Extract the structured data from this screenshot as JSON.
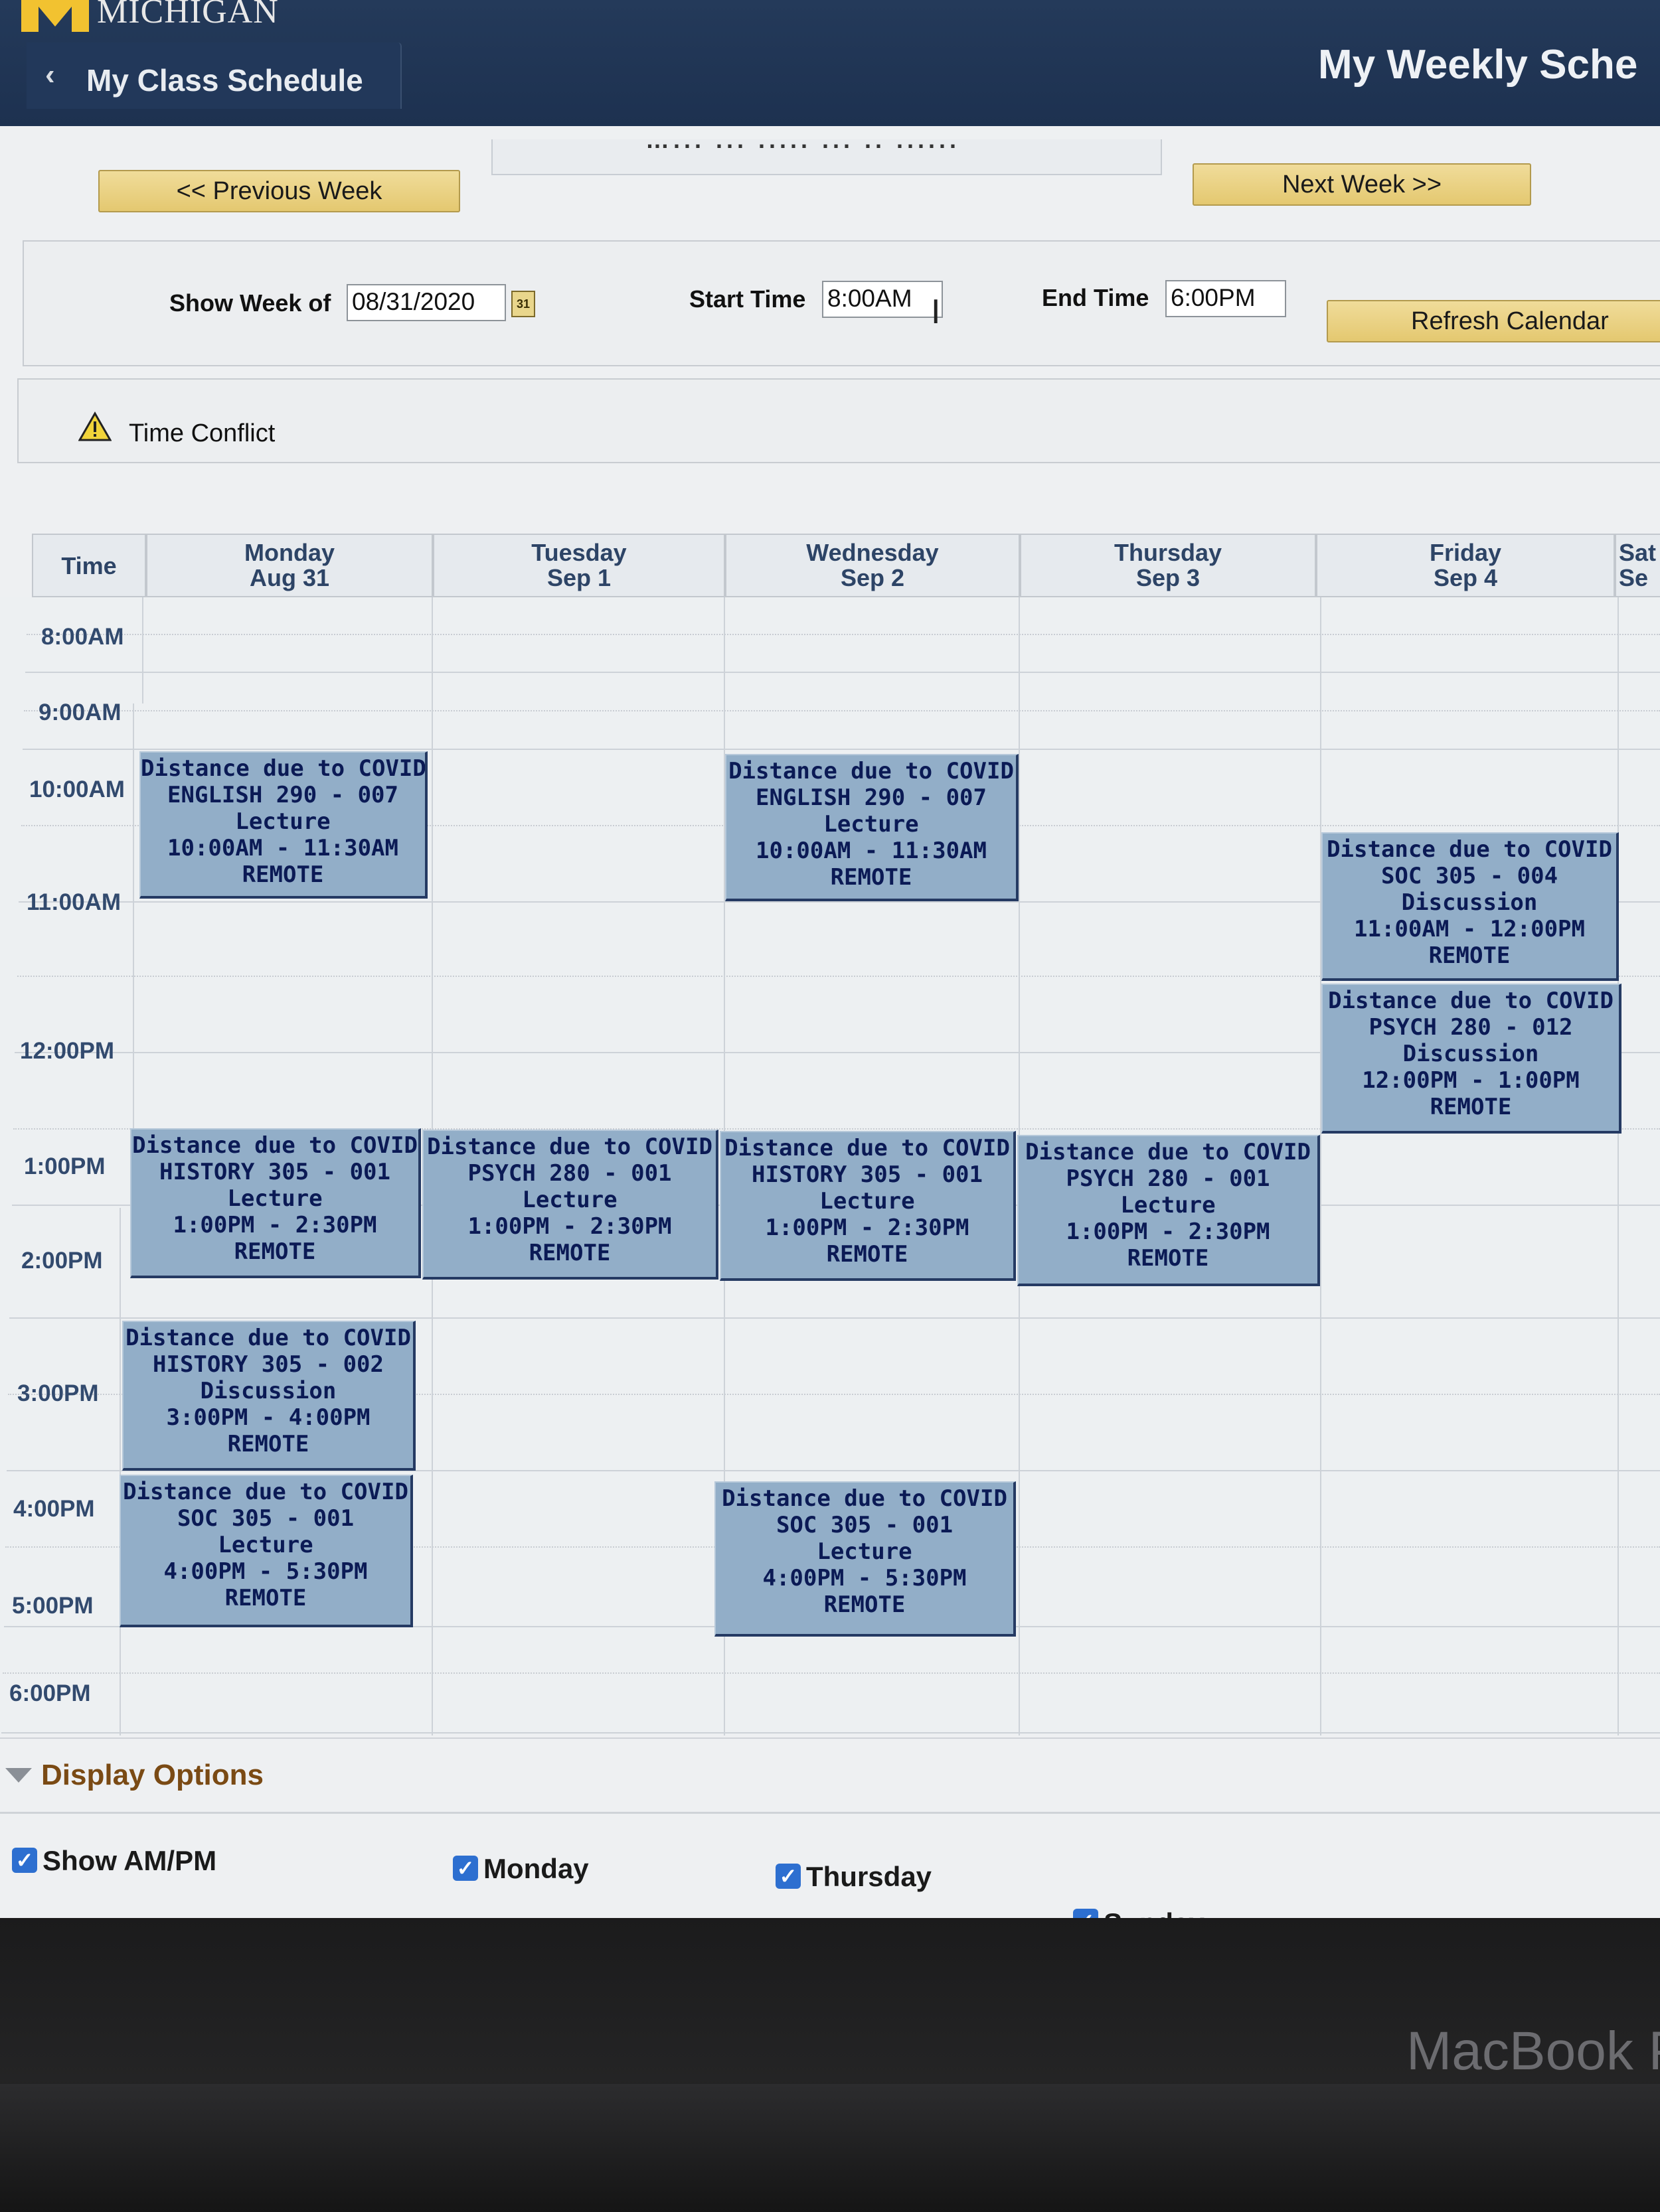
{
  "header": {
    "logo_letter": "M",
    "university": "MICHIGAN",
    "back_label": "My Class Schedule",
    "page_title": "My Weekly Sche"
  },
  "navigation": {
    "prev_week": "<< Previous Week",
    "next_week": "Next Week >>",
    "week_strip": "…... ... ..... ... .. ......"
  },
  "filters": {
    "show_week_label": "Show Week of",
    "show_week_value": "08/31/2020",
    "start_time_label": "Start Time",
    "start_time_value": "8:00AM",
    "end_time_label": "End Time",
    "end_time_value": "6:00PM",
    "refresh_label": "Refresh Calendar",
    "calendar_icon_text": "31"
  },
  "legend": {
    "label": "Time Conflict"
  },
  "calendar": {
    "time_header": "Time",
    "days": [
      {
        "name": "Monday",
        "date": "Aug 31"
      },
      {
        "name": "Tuesday",
        "date": "Sep 1"
      },
      {
        "name": "Wednesday",
        "date": "Sep 2"
      },
      {
        "name": "Thursday",
        "date": "Sep 3"
      },
      {
        "name": "Friday",
        "date": "Sep 4"
      },
      {
        "name": "Sat",
        "date": "Se"
      }
    ],
    "times": [
      "8:00AM",
      "9:00AM",
      "10:00AM",
      "11:00AM",
      "12:00PM",
      "1:00PM",
      "2:00PM",
      "3:00PM",
      "4:00PM",
      "5:00PM",
      "6:00PM"
    ],
    "events": [
      {
        "lines": [
          "Distance due to COVID",
          "ENGLISH 290 - 007",
          "Lecture",
          "10:00AM - 11:30AM",
          "REMOTE"
        ]
      },
      {
        "lines": [
          "Distance due to COVID",
          "ENGLISH 290 - 007",
          "Lecture",
          "10:00AM - 11:30AM",
          "REMOTE"
        ]
      },
      {
        "lines": [
          "Distance due to COVID",
          "SOC 305 - 004",
          "Discussion",
          "11:00AM - 12:00PM",
          "REMOTE"
        ]
      },
      {
        "lines": [
          "Distance due to COVID",
          "PSYCH 280 - 012",
          "Discussion",
          "12:00PM - 1:00PM",
          "REMOTE"
        ]
      },
      {
        "lines": [
          "Distance due to COVID",
          "HISTORY 305 - 001",
          "Lecture",
          "1:00PM - 2:30PM",
          "REMOTE"
        ]
      },
      {
        "lines": [
          "Distance due to COVID",
          "PSYCH 280 - 001",
          "Lecture",
          "1:00PM - 2:30PM",
          "REMOTE"
        ]
      },
      {
        "lines": [
          "Distance due to COVID",
          "HISTORY 305 - 001",
          "Lecture",
          "1:00PM - 2:30PM",
          "REMOTE"
        ]
      },
      {
        "lines": [
          "Distance due to COVID",
          "PSYCH 280 - 001",
          "Lecture",
          "1:00PM - 2:30PM",
          "REMOTE"
        ]
      },
      {
        "lines": [
          "Distance due to COVID",
          "HISTORY 305 - 002",
          "Discussion",
          "3:00PM - 4:00PM",
          "REMOTE"
        ]
      },
      {
        "lines": [
          "Distance due to COVID",
          "SOC 305 - 001",
          "Lecture",
          "4:00PM - 5:30PM",
          "REMOTE"
        ]
      },
      {
        "lines": [
          "Distance due to COVID",
          "SOC 305 - 001",
          "Lecture",
          "4:00PM - 5:30PM",
          "REMOTE"
        ]
      }
    ]
  },
  "display_options": {
    "title": "Display Options",
    "options": [
      {
        "label": "Show AM/PM",
        "checked": true
      },
      {
        "label": "Monday",
        "checked": true
      },
      {
        "label": "Thursday",
        "checked": true
      },
      {
        "label": "Sunday",
        "checked": true
      }
    ]
  },
  "device": {
    "label": "MacBook P"
  },
  "colors": {
    "header_bg": "#1d3150",
    "button_gold": "#e4c870",
    "event_bg": "#92aec8",
    "event_text": "#0b1a55",
    "options_title": "#7a4a14",
    "checkbox": "#2d6fd0"
  }
}
